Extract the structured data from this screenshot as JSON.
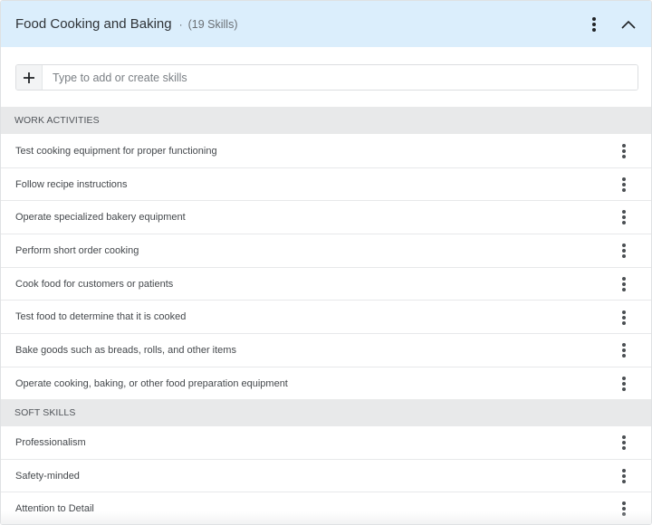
{
  "header": {
    "title": "Food Cooking and Baking",
    "separator": "·",
    "count": "(19 Skills)",
    "menu_icon": "kebab-vertical-icon",
    "collapse_icon": "chevron-up-icon"
  },
  "add_skill": {
    "button_icon": "plus-icon",
    "placeholder": "Type to add or create skills",
    "value": ""
  },
  "sections": [
    {
      "title": "WORK ACTIVITIES",
      "items": [
        "Test cooking equipment for proper functioning",
        "Follow recipe instructions",
        "Operate specialized bakery equipment",
        "Perform short order cooking",
        "Cook food for customers or patients",
        "Test food to determine that it is cooked",
        "Bake goods such as breads, rolls, and other items",
        "Operate cooking, baking, or other food preparation equipment"
      ]
    },
    {
      "title": "SOFT SKILLS",
      "items": [
        "Professionalism",
        "Safety-minded",
        "Attention to Detail"
      ]
    }
  ],
  "colors": {
    "header_bg": "#dbeefc",
    "section_bg": "#e8e9ea"
  }
}
